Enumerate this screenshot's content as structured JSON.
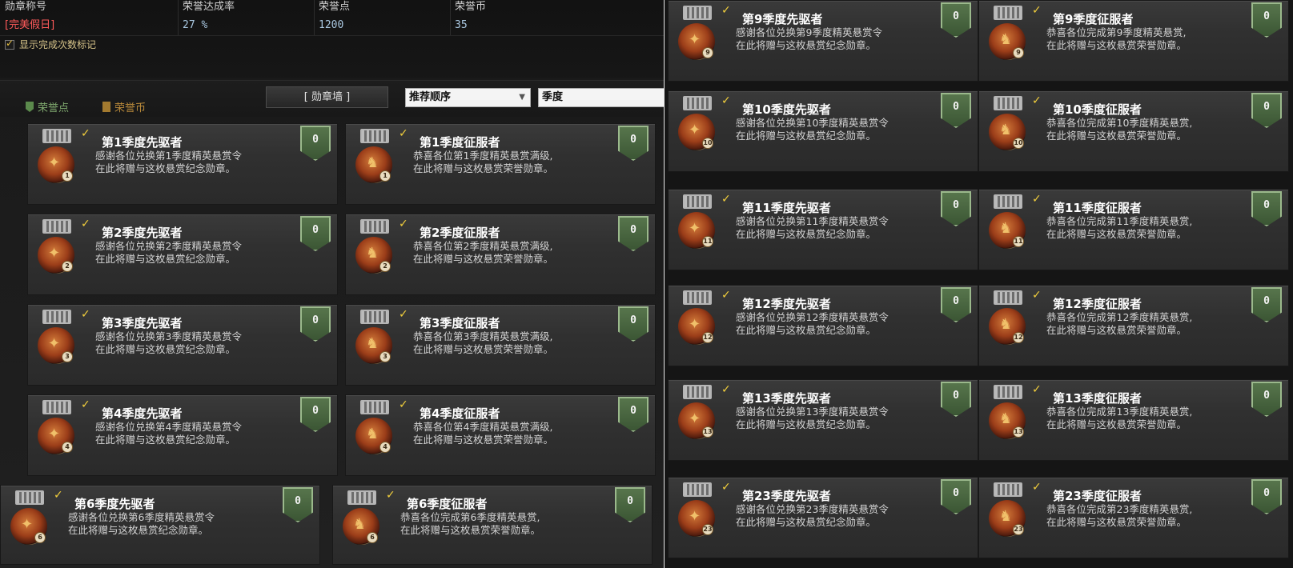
{
  "header": {
    "title_label": "勋章称号",
    "title_value": "[完美假日]",
    "rate_label": "荣誉达成率",
    "rate_value": "27 %",
    "points_label": "荣誉点",
    "points_value": "1200",
    "coins_label": "荣誉币",
    "coins_value": "35",
    "show_count_label": "显示完成次数标记",
    "show_count_checked": true
  },
  "filters": {
    "legend_points": "荣誉点",
    "legend_coins": "荣誉币",
    "wall_button": "[ 勋章墙 ]",
    "sort_value": "推荐顺序",
    "search_value": "季度"
  },
  "colors": {
    "accent_gold": "#f2cf3c",
    "title_red": "#ff5a5a",
    "badge_green": "#4d6a43"
  },
  "cards_left": [
    {
      "title": "第1季度先驱者",
      "line1": "感谢各位兑换第1季度精英悬赏令",
      "line2": "在此将赠与这枚悬赏纪念勋章。",
      "count": "0",
      "num": "1",
      "type": "pioneer"
    },
    {
      "title": "第1季度征服者",
      "line1": "恭喜各位第1季度精英悬赏满级,",
      "line2": "在此将赠与这枚悬赏荣誉勋章。",
      "count": "0",
      "num": "1",
      "type": "conqueror"
    },
    {
      "title": "第2季度先驱者",
      "line1": "感谢各位兑换第2季度精英悬赏令",
      "line2": "在此将赠与这枚悬赏纪念勋章。",
      "count": "0",
      "num": "2",
      "type": "pioneer"
    },
    {
      "title": "第2季度征服者",
      "line1": "恭喜各位第2季度精英悬赏满级,",
      "line2": "在此将赠与这枚悬赏荣誉勋章。",
      "count": "0",
      "num": "2",
      "type": "conqueror"
    },
    {
      "title": "第3季度先驱者",
      "line1": "感谢各位兑换第3季度精英悬赏令",
      "line2": "在此将赠与这枚悬赏纪念勋章。",
      "count": "0",
      "num": "3",
      "type": "pioneer"
    },
    {
      "title": "第3季度征服者",
      "line1": "恭喜各位第3季度精英悬赏满级,",
      "line2": "在此将赠与这枚悬赏荣誉勋章。",
      "count": "0",
      "num": "3",
      "type": "conqueror"
    },
    {
      "title": "第4季度先驱者",
      "line1": "感谢各位兑换第4季度精英悬赏令",
      "line2": "在此将赠与这枚悬赏纪念勋章。",
      "count": "0",
      "num": "4",
      "type": "pioneer"
    },
    {
      "title": "第4季度征服者",
      "line1": "恭喜各位第4季度精英悬赏满级,",
      "line2": "在此将赠与这枚悬赏荣誉勋章。",
      "count": "0",
      "num": "4",
      "type": "conqueror"
    },
    {
      "title": "第6季度先驱者",
      "line1": "感谢各位兑换第6季度精英悬赏令",
      "line2": "在此将赠与这枚悬赏纪念勋章。",
      "count": "0",
      "num": "6",
      "type": "pioneer"
    },
    {
      "title": "第6季度征服者",
      "line1": "恭喜各位完成第6季度精英悬赏,",
      "line2": "在此将赠与这枚悬赏荣誉勋章。",
      "count": "0",
      "num": "6",
      "type": "conqueror"
    }
  ],
  "cards_right": [
    {
      "title": "第9季度先驱者",
      "line1": "感谢各位兑换第9季度精英悬赏令",
      "line2": "在此将赠与这枚悬赏纪念勋章。",
      "count": "0",
      "num": "9",
      "type": "pioneer"
    },
    {
      "title": "第9季度征服者",
      "line1": "恭喜各位完成第9季度精英悬赏,",
      "line2": "在此将赠与这枚悬赏荣誉勋章。",
      "count": "0",
      "num": "9",
      "type": "conqueror"
    },
    {
      "title": "第10季度先驱者",
      "line1": "感谢各位兑换第10季度精英悬赏令",
      "line2": "在此将赠与这枚悬赏纪念勋章。",
      "count": "0",
      "num": "10",
      "type": "pioneer"
    },
    {
      "title": "第10季度征服者",
      "line1": "恭喜各位完成第10季度精英悬赏,",
      "line2": "在此将赠与这枚悬赏荣誉勋章。",
      "count": "0",
      "num": "10",
      "type": "conqueror"
    },
    {
      "title": "第11季度先驱者",
      "line1": "感谢各位兑换第11季度精英悬赏令",
      "line2": "在此将赠与这枚悬赏纪念勋章。",
      "count": "0",
      "num": "11",
      "type": "pioneer"
    },
    {
      "title": "第11季度征服者",
      "line1": "恭喜各位完成第11季度精英悬赏,",
      "line2": "在此将赠与这枚悬赏荣誉勋章。",
      "count": "0",
      "num": "11",
      "type": "conqueror"
    },
    {
      "title": "第12季度先驱者",
      "line1": "感谢各位兑换第12季度精英悬赏令",
      "line2": "在此将赠与这枚悬赏纪念勋章。",
      "count": "0",
      "num": "12",
      "type": "pioneer"
    },
    {
      "title": "第12季度征服者",
      "line1": "恭喜各位完成第12季度精英悬赏,",
      "line2": "在此将赠与这枚悬赏荣誉勋章。",
      "count": "0",
      "num": "12",
      "type": "conqueror"
    },
    {
      "title": "第13季度先驱者",
      "line1": "感谢各位兑换第13季度精英悬赏令",
      "line2": "在此将赠与这枚悬赏纪念勋章。",
      "count": "0",
      "num": "13",
      "type": "pioneer"
    },
    {
      "title": "第13季度征服者",
      "line1": "恭喜各位完成第13季度精英悬赏,",
      "line2": "在此将赠与这枚悬赏荣誉勋章。",
      "count": "0",
      "num": "13",
      "type": "conqueror"
    },
    {
      "title": "第23季度先驱者",
      "line1": "感谢各位兑换第23季度精英悬赏令",
      "line2": "在此将赠与这枚悬赏纪念勋章。",
      "count": "0",
      "num": "23",
      "type": "pioneer"
    },
    {
      "title": "第23季度征服者",
      "line1": "恭喜各位完成第23季度精英悬赏,",
      "line2": "在此将赠与这枚悬赏荣誉勋章。",
      "count": "0",
      "num": "23",
      "type": "conqueror"
    }
  ]
}
